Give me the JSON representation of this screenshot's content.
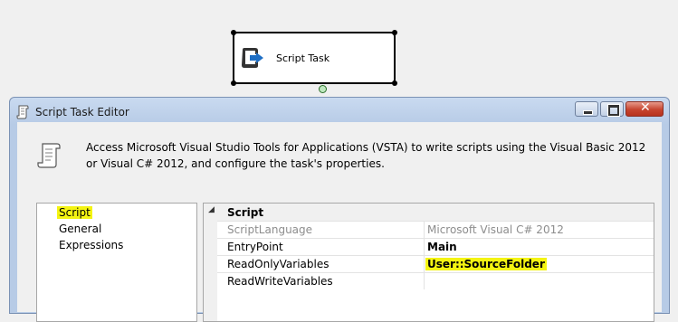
{
  "canvas": {
    "task_label": "Script Task",
    "task_icon": "script-task-icon",
    "connector_color": "#2a6e2a"
  },
  "editor": {
    "title": "Script Task Editor",
    "title_icon": "scroll-icon",
    "buttons": [
      "minimize",
      "maximize",
      "close"
    ],
    "description": "Access Microsoft Visual Studio Tools for Applications (VSTA) to write scripts using the Visual Basic 2012 or Visual C# 2012, and configure the task's properties.",
    "description_icon": "scroll-icon",
    "nav": {
      "items": [
        "Script",
        "General",
        "Expressions"
      ],
      "selected": "Script"
    },
    "properties": {
      "category": "Script",
      "rows": [
        {
          "name": "ScriptLanguage",
          "value": "Microsoft Visual C# 2012"
        },
        {
          "name": "EntryPoint",
          "value": "Main"
        },
        {
          "name": "ReadOnlyVariables",
          "value": "User::SourceFolder"
        },
        {
          "name": "ReadWriteVariables",
          "value": ""
        }
      ]
    },
    "highlight_color": "#f4f412"
  }
}
